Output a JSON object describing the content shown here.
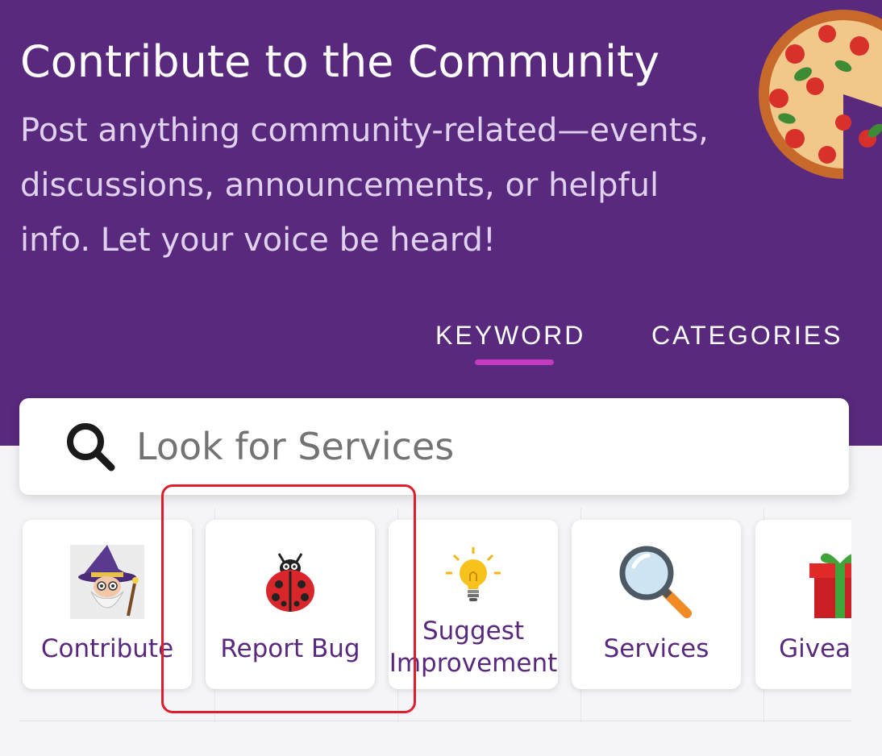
{
  "hero": {
    "title": "Contribute to the Community",
    "subtitle": "Post anything community-related—events, discussions, announcements, or helpful info. Let your voice be heard!",
    "background_color": "#58297d",
    "decoration_icon": "pizza-slice-image"
  },
  "tabs": [
    {
      "label": "KEYWORD",
      "active": true
    },
    {
      "label": "CATEGORIES",
      "active": false
    }
  ],
  "search": {
    "placeholder": "Look for Services",
    "value": "",
    "icon": "search-icon"
  },
  "cards": [
    {
      "label": "Contribute",
      "icon": "wizard-icon"
    },
    {
      "label": "Report Bug",
      "icon": "ladybug-icon"
    },
    {
      "label": "Suggest Improvement",
      "icon": "lightbulb-icon"
    },
    {
      "label": "Services",
      "icon": "magnifier-icon"
    },
    {
      "label": "Giveaway",
      "icon": "gift-icon"
    }
  ],
  "colors": {
    "accent": "#58297d",
    "tab_indicator": "#c33cc0",
    "highlight": "#e01d2d"
  }
}
